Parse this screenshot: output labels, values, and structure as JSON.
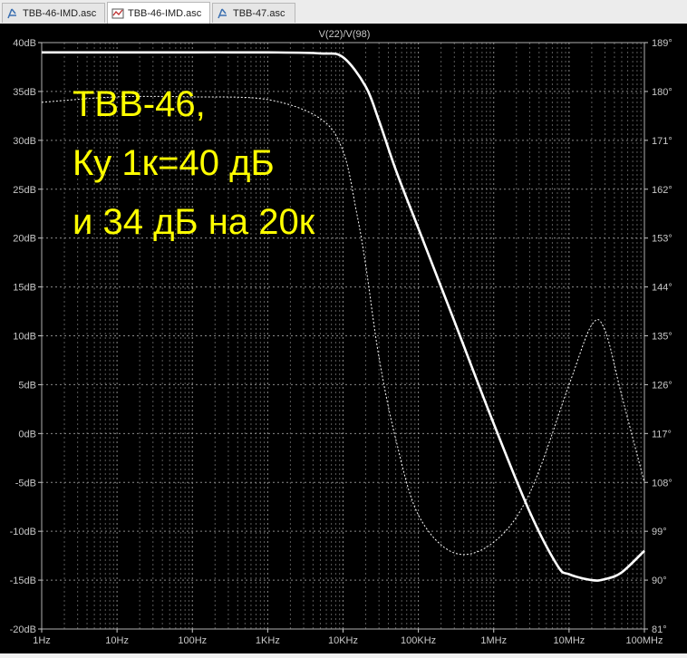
{
  "tabs": [
    {
      "label": "TBB-46-IMD.asc",
      "icon": "schematic-icon",
      "active": false
    },
    {
      "label": "TBB-46-IMD.asc",
      "icon": "waveform-icon",
      "active": true
    },
    {
      "label": "TBB-47.asc",
      "icon": "schematic-icon",
      "active": false
    }
  ],
  "chart_data": {
    "type": "line",
    "title": "V(22)/V(98)",
    "x_scale": "log",
    "xlim": [
      1,
      100000000
    ],
    "ylim_left": [
      -20,
      40
    ],
    "ylim_right": [
      81,
      189
    ],
    "x_ticks": [
      "1Hz",
      "10Hz",
      "100Hz",
      "1KHz",
      "10KHz",
      "100KHz",
      "1MHz",
      "10MHz",
      "100MHz"
    ],
    "y_ticks_left": [
      "40dB",
      "35dB",
      "30dB",
      "25dB",
      "20dB",
      "15dB",
      "10dB",
      "5dB",
      "0dB",
      "-5dB",
      "-10dB",
      "-15dB",
      "-20dB"
    ],
    "y_ticks_right": [
      "189°",
      "180°",
      "171°",
      "162°",
      "153°",
      "144°",
      "135°",
      "126°",
      "117°",
      "108°",
      "99°",
      "90°",
      "81°"
    ],
    "grid": true,
    "annotation": [
      "ТВВ-46,",
      "Ку 1к=40 дБ",
      "и 34 дБ на 20к"
    ],
    "annotation_color": "#ffff00",
    "background": "#000000",
    "series": [
      {
        "style": "solid",
        "axis": "left",
        "x": [
          1,
          10,
          100,
          1000,
          5000,
          10000,
          20000,
          30000,
          50000,
          100000,
          300000,
          1000000,
          3000000,
          7000000,
          10000000,
          20000000,
          30000000,
          50000000,
          100000000
        ],
        "y": [
          39,
          39,
          39,
          39,
          38.9,
          38.5,
          35.5,
          32,
          27,
          21,
          11.5,
          1,
          -8,
          -13.5,
          -14.4,
          -15,
          -14.9,
          -14.2,
          -12
        ]
      },
      {
        "style": "dashed",
        "axis": "right",
        "x": [
          1,
          10,
          100,
          1000,
          5000,
          10000,
          15000,
          20000,
          30000,
          50000,
          100000,
          300000,
          1000000,
          3000000,
          10000000,
          20000000,
          30000000,
          50000000,
          100000000
        ],
        "y": [
          178,
          179,
          179,
          178.5,
          175,
          169,
          158,
          148,
          131,
          116,
          102,
          95,
          97,
          106,
          126,
          137,
          136,
          124,
          108
        ]
      }
    ]
  }
}
